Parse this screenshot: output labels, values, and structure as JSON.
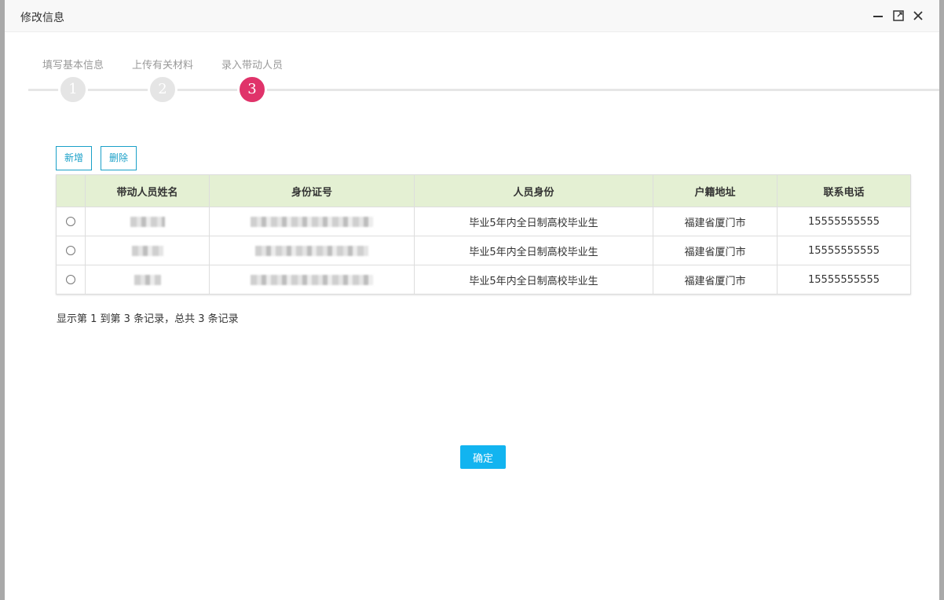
{
  "window": {
    "title": "修改信息",
    "minimize_icon": "minimize-icon",
    "maximize_icon": "maximize-icon",
    "close_icon": "close-icon"
  },
  "steps": [
    {
      "label": "填写基本信息",
      "number": "1",
      "active": false
    },
    {
      "label": "上传有关材料",
      "number": "2",
      "active": false
    },
    {
      "label": "录入带动人员",
      "number": "3",
      "active": true
    }
  ],
  "toolbar": {
    "add_label": "新增",
    "delete_label": "删除"
  },
  "table": {
    "columns": [
      "带动人员姓名",
      "身份证号",
      "人员身份",
      "户籍地址",
      "联系电话"
    ],
    "rows": [
      {
        "identity": "毕业5年内全日制高校毕业生",
        "address": "福建省厦门市",
        "phone": "15555555555"
      },
      {
        "identity": "毕业5年内全日制高校毕业生",
        "address": "福建省厦门市",
        "phone": "15555555555"
      },
      {
        "identity": "毕业5年内全日制高校毕业生",
        "address": "福建省厦门市",
        "phone": "15555555555"
      }
    ]
  },
  "summary": "显示第 1 到第 3 条记录，总共 3 条记录",
  "confirm_label": "确定",
  "colors": {
    "active_step": "#e0336a",
    "inactive_step": "#e5e5e5",
    "header_bg": "#e4f0d3",
    "outline_button": "#1aa0c8",
    "confirm_button": "#12b4f0"
  }
}
